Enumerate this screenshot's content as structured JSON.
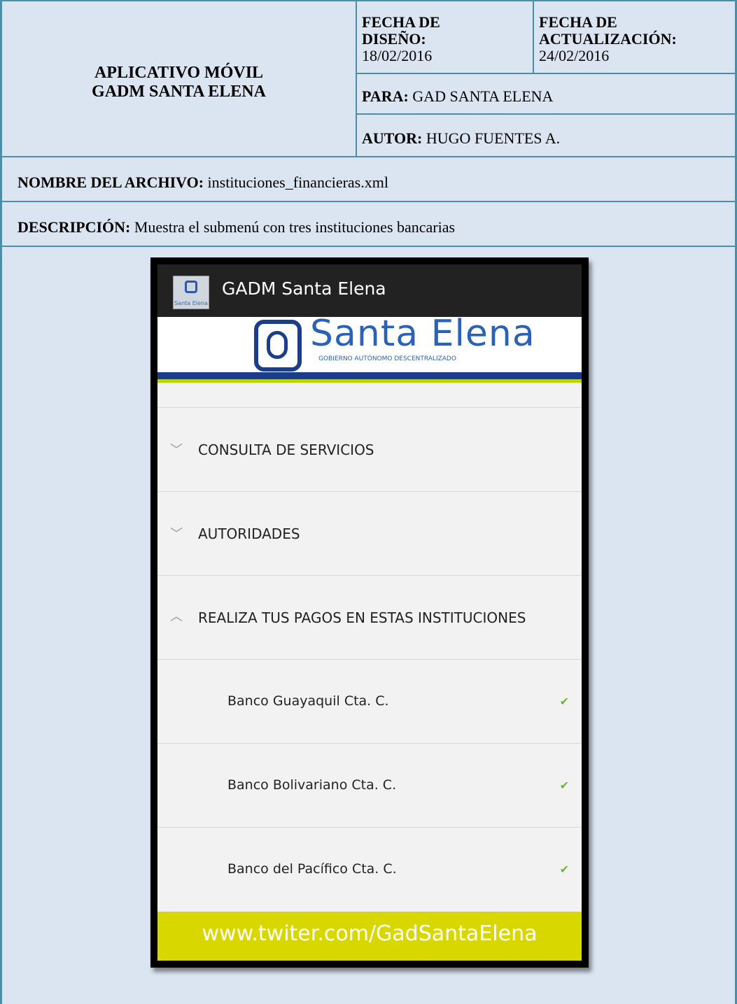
{
  "header": {
    "title_line1": "APLICATIVO MÓVIL",
    "title_line2": "GADM SANTA ELENA",
    "fecha_diseno_label_1": "FECHA DE",
    "fecha_diseno_label_2": "DISEÑO:",
    "fecha_diseno_value": "18/02/2016",
    "fecha_act_label_1": "FECHA DE",
    "fecha_act_label_2": "ACTUALIZACIÓN:",
    "fecha_act_value": "24/02/2016",
    "para_label": "PARA:",
    "para_value": "GAD SANTA ELENA",
    "autor_label": "AUTOR:",
    "autor_value": "HUGO FUENTES A."
  },
  "archivo": {
    "label": "NOMBRE DEL ARCHIVO:",
    "value": "instituciones_financieras.xml"
  },
  "descripcion": {
    "label": "DESCRIPCIÓN:",
    "value": "Muestra el submenú con tres instituciones bancarias"
  },
  "app": {
    "title": "GADM Santa Elena",
    "icon_label": "Santa Elena",
    "logo_text": "Santa Elena",
    "logo_subtext": "GOBIERNO AUTÓNOMO DESCENTRALIZADO",
    "menu": [
      {
        "label": "CONSULTA DE SERVICIOS",
        "icon": "chevron-down-icon"
      },
      {
        "label": "AUTORIDADES",
        "icon": "chevron-down-icon"
      },
      {
        "label": "REALIZA TUS PAGOS EN ESTAS INSTITUCIONES",
        "icon": "chevron-up-icon"
      }
    ],
    "banks": [
      {
        "label": "Banco Guayaquil Cta. C."
      },
      {
        "label": "Banco Bolivariano Cta. C."
      },
      {
        "label": "Banco del Pacífico Cta. C."
      }
    ],
    "footer": "www.twiter.com/GadSantaElena",
    "colors": {
      "appbar": "#222222",
      "logo_blue": "#1a3e8c",
      "footer": "#d8d800",
      "check": "#6cb33f"
    }
  }
}
